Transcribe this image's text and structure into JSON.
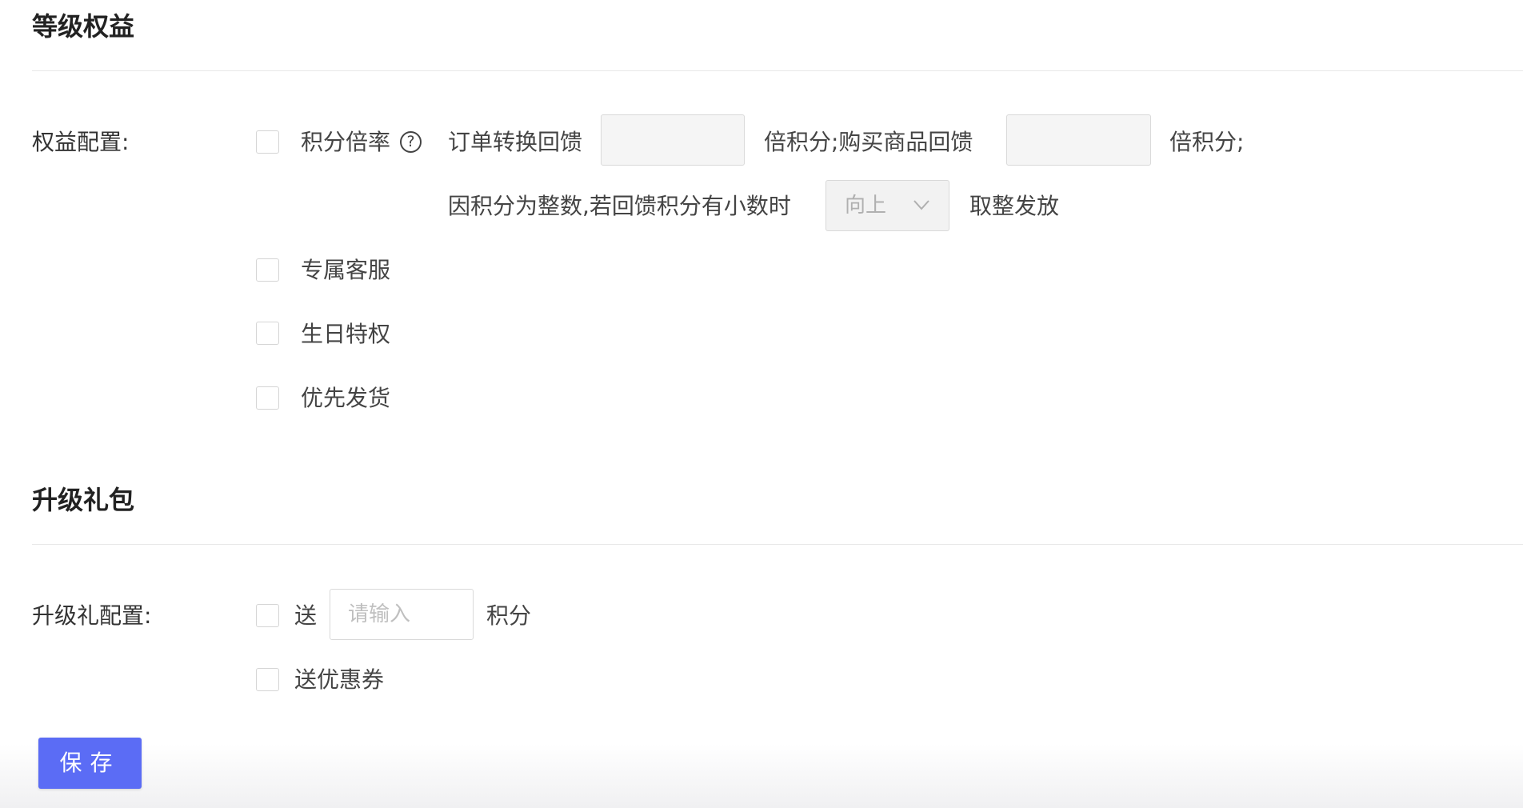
{
  "level_benefits": {
    "title": "等级权益",
    "config_label": "权益配置:",
    "points_rate": {
      "checkbox_label": "积分倍率",
      "help_icon": "question-circle-icon",
      "order_text": "订单转换回馈",
      "order_value": "",
      "multiplier_text_1": "倍积分;购买商品回馈",
      "purchase_value": "",
      "multiplier_text_2": "倍积分;",
      "rounding_prefix": "因积分为整数,若回馈积分有小数时",
      "rounding_selected": "向上",
      "rounding_icon": "chevron-down-icon",
      "rounding_suffix": "取整发放"
    },
    "options": [
      {
        "label": "专属客服"
      },
      {
        "label": "生日特权"
      },
      {
        "label": "优先发货"
      }
    ]
  },
  "upgrade_gift": {
    "title": "升级礼包",
    "config_label": "升级礼配置:",
    "points_gift": {
      "prefix": "送",
      "placeholder": "请输入",
      "suffix": "积分"
    },
    "coupon_label": "送优惠券"
  },
  "save_button": {
    "label": "保存"
  },
  "colors": {
    "primary": "#5b6cf5",
    "border": "#d9d9d9",
    "divider": "#e8e8e8"
  }
}
